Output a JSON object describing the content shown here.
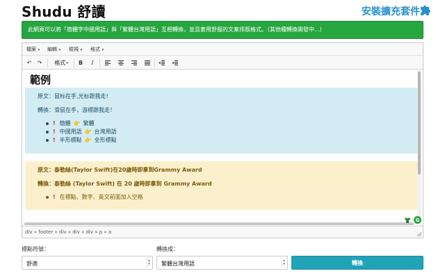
{
  "header": {
    "title": "Shudu 舒讀",
    "install_link": "安裝擴充套件"
  },
  "banner": {
    "text": "此網頁可以將「簡體字中國用語」與「繁體台灣用語」互相轉換，並且套用舒服的文案排版格式。（其他種轉換開發中...）"
  },
  "editor": {
    "menu": [
      "檔案",
      "編輯",
      "檢視",
      "格式"
    ],
    "toolbar": {
      "format_label": "格式",
      "bold": "B",
      "italic": "I"
    },
    "content": {
      "heading": "範例",
      "blue_box": {
        "original": "原文：鼠标在手,光标跟我走!",
        "converted": "轉換：滑鼠在手，游標跟我走！",
        "bullets": [
          {
            "from": "簡體",
            "to": "繁體"
          },
          {
            "from": "中國用語",
            "to": "台灣用語"
          },
          {
            "from": "半形標點",
            "to": "全形標點"
          }
        ]
      },
      "yellow_box": {
        "original": "原文：泰勒絲(Taylor Swift)在20歲時即拿到Grammy Award",
        "converted": "轉換：泰勒絲 (Taylor Swift) 在 20 歲時即拿到 Grammy Award",
        "bullets": [
          {
            "text": "在標點、數字、英文前面加入空格"
          }
        ]
      }
    },
    "status_path": "div » footer » div » div » div » p » a"
  },
  "controls": {
    "punct_label": "標點符號：",
    "punct_value": "舒適",
    "convert_to_label": "轉換成：",
    "convert_to_value": "繁體台灣用語",
    "convert_button": "轉換"
  },
  "colors": {
    "banner_green": "#26a63e",
    "link_blue": "#2a8fcf",
    "blue_box": "#d3ecf3",
    "yellow_box": "#fcf0cc",
    "button_teal": "#21a3b8",
    "bullet_red": "#d62222"
  },
  "icons": {
    "puzzle": "puzzle-icon",
    "undo": "undo-icon",
    "redo": "redo-icon",
    "align_left": "align-left-icon",
    "align_center": "align-center-icon",
    "align_right": "align-right-icon",
    "justify": "align-justify-icon",
    "outdent": "outdent-icon",
    "indent": "indent-icon",
    "hand": "pointing-hand-icon",
    "shirt": "shirt-icon",
    "grammar": "grammarly-icon"
  }
}
